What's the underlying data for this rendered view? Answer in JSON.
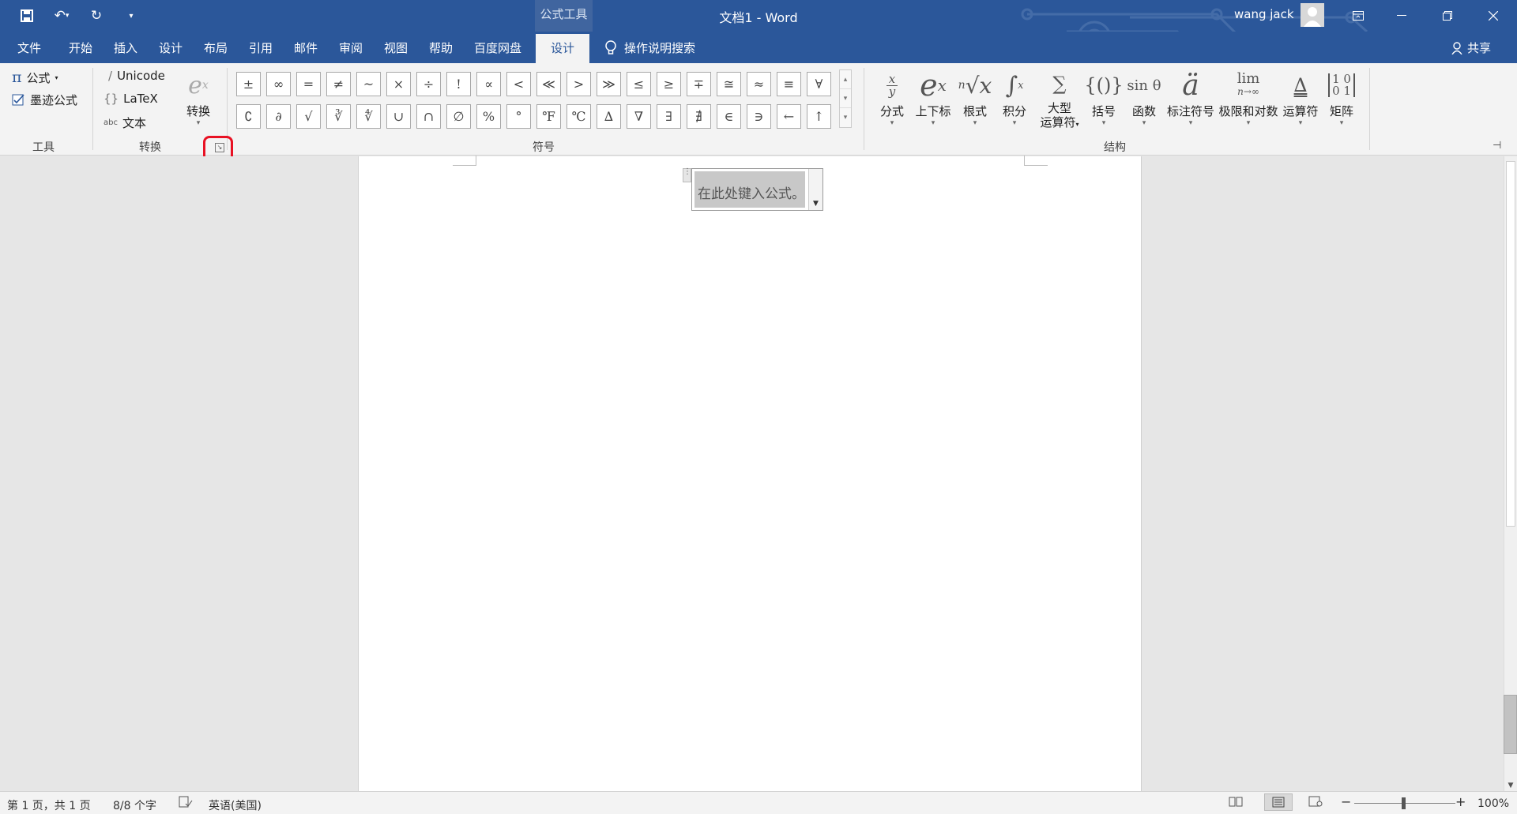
{
  "titlebar": {
    "context_tab": "公式工具",
    "doc_title": "文档1  -  Word",
    "user_name": "wang jack"
  },
  "tabs": [
    {
      "label": "文件"
    },
    {
      "label": "开始"
    },
    {
      "label": "插入"
    },
    {
      "label": "设计"
    },
    {
      "label": "布局"
    },
    {
      "label": "引用"
    },
    {
      "label": "邮件"
    },
    {
      "label": "审阅"
    },
    {
      "label": "视图"
    },
    {
      "label": "帮助"
    },
    {
      "label": "百度网盘"
    },
    {
      "label": "设计"
    }
  ],
  "tell_me": "操作说明搜索",
  "share": "共享",
  "ribbon": {
    "tools": {
      "equation": "公式",
      "ink_equation": "墨迹公式",
      "group": "工具"
    },
    "conversions": {
      "unicode": "Unicode",
      "latex": "LaTeX",
      "text": "文本",
      "convert": "转换",
      "group": "转换"
    },
    "symbols": {
      "group": "符号",
      "row1": [
        "±",
        "∞",
        "=",
        "≠",
        "~",
        "×",
        "÷",
        "!",
        "∝",
        "<",
        "≪",
        ">",
        "≫",
        "≤",
        "≥",
        "∓",
        "≅",
        "≈",
        "≡",
        "∀"
      ],
      "row2": [
        "∁",
        "∂",
        "√",
        "∛",
        "∜",
        "∪",
        "∩",
        "∅",
        "%",
        "°",
        "℉",
        "℃",
        "∆",
        "∇",
        "∃",
        "∄",
        "∈",
        "∋",
        "←",
        "↑"
      ]
    },
    "structures": {
      "group": "结构",
      "items": [
        {
          "label": "分式"
        },
        {
          "label": "上下标"
        },
        {
          "label": "根式"
        },
        {
          "label": "积分"
        },
        {
          "label": "大型",
          "label2": "运算符"
        },
        {
          "label": "括号"
        },
        {
          "label": "函数"
        },
        {
          "label": "标注符号"
        },
        {
          "label": "极限和对数"
        },
        {
          "label": "运算符"
        },
        {
          "label": "矩阵"
        }
      ]
    }
  },
  "document": {
    "equation_placeholder": "在此处键入公式。"
  },
  "statusbar": {
    "page": "第 1 页，共 1 页",
    "words": "8/8 个字",
    "language": "英语(美国)",
    "zoom": "100%"
  }
}
